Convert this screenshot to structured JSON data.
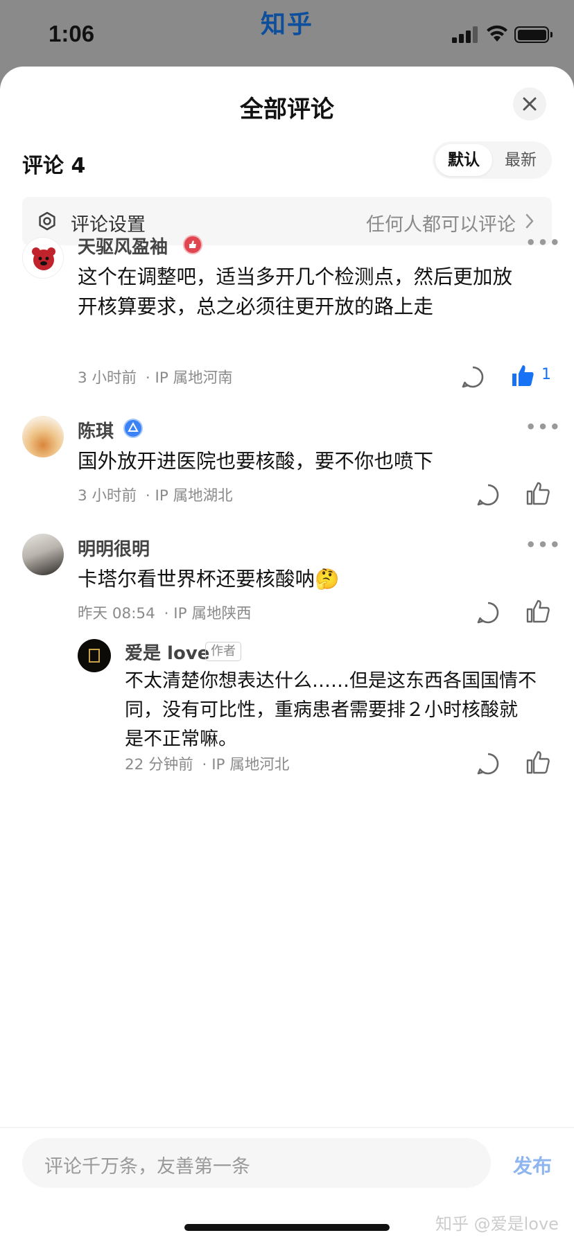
{
  "status_bar": {
    "time": "1:06",
    "app_name": "知乎"
  },
  "sheet": {
    "title": "全部评论"
  },
  "header": {
    "count_label": "评论 4"
  },
  "sort": {
    "default": "默认",
    "latest": "最新"
  },
  "settings": {
    "label": "评论设置",
    "value": "任何人都可以评论"
  },
  "comments": [
    {
      "user": "天驱风盈袖",
      "badge_color": "#e0464f",
      "lines": [
        "这个在调整吧，适当多开几个检测点，然后更加放",
        "开核算要求，总之必须往更开放的路上走"
      ],
      "time": "3 小时前",
      "ip": "· IP 属地河南",
      "liked": true,
      "like_count": "1"
    },
    {
      "user": "陈琪",
      "badge_color": "#3b82f6",
      "lines": [
        "国外放开进医院也要核酸，要不你也喷下"
      ],
      "time": "3 小时前",
      "ip": "· IP 属地湖北",
      "liked": false
    },
    {
      "user": "明明很明",
      "lines": [
        "卡塔尔看世界杯还要核酸呐"
      ],
      "emoji": "🤔",
      "time": "昨天 08:54",
      "ip": "· IP 属地陕西",
      "liked": false
    }
  ],
  "reply": {
    "user": "爱是 love",
    "tag": "作者",
    "lines": [
      "不太清楚你想表达什么……但是这东西各国国情不",
      "同，没有可比性，重病患者需要排２小时核酸就",
      "是不正常嘛。"
    ],
    "time": "22 分钟前",
    "ip": "· IP 属地河北"
  },
  "composer": {
    "placeholder": "评论千万条，友善第一条",
    "publish": "发布"
  },
  "watermark": "知乎 @爱是love",
  "colors": {
    "accent": "#1772f6",
    "publish_disabled": "#8fb5f0",
    "meta": "#8a8a8a"
  }
}
